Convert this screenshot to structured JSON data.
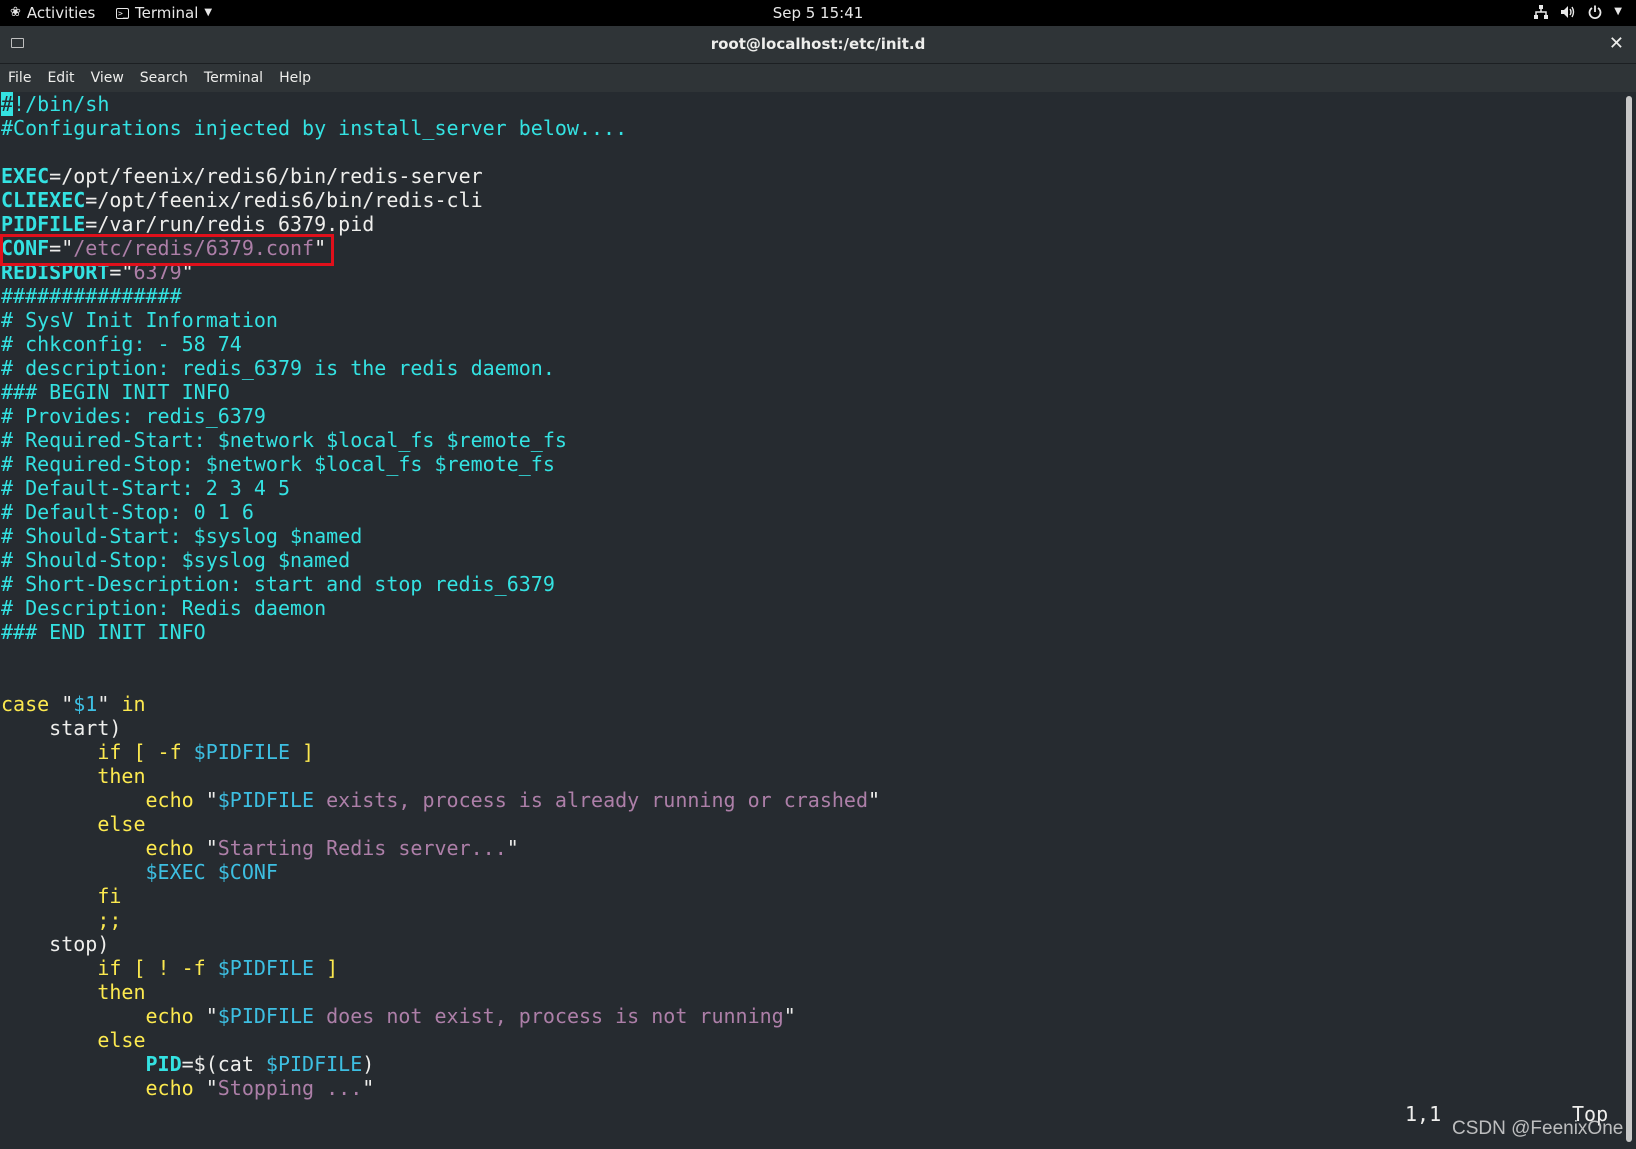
{
  "topbar": {
    "activities_label": "Activities",
    "app_label": "Terminal",
    "clock": "Sep 5  15:41",
    "icons": [
      "network-icon",
      "volume-icon",
      "power-icon",
      "chevron-down-icon"
    ]
  },
  "window": {
    "title": "root@localhost:/etc/init.d",
    "close_glyph": "✕"
  },
  "menubar": {
    "items": [
      "File",
      "Edit",
      "View",
      "Search",
      "Terminal",
      "Help"
    ]
  },
  "terminal": {
    "colors": {
      "background": "#262b30",
      "comment": "#34e2e2",
      "string": "#ad7fa8",
      "keyword": "#fce94f",
      "variable": "#3dbfe2",
      "highlight_box": "#e0101b"
    },
    "lines": [
      [
        {
          "t": "#",
          "c": "cursor"
        },
        {
          "t": "!/bin/sh",
          "c": "c"
        }
      ],
      [
        {
          "t": "#Configurations injected by install_server below....",
          "c": "c"
        }
      ],
      [],
      [
        {
          "t": "EXEC",
          "c": "v"
        },
        {
          "t": "=/opt/feenix/redis6/bin/redis-server",
          "c": ""
        }
      ],
      [
        {
          "t": "CLIEXEC",
          "c": "v"
        },
        {
          "t": "=/opt/feenix/redis6/bin/redis-cli",
          "c": ""
        }
      ],
      [
        {
          "t": "PIDFILE",
          "c": "v"
        },
        {
          "t": "=/var/run/redis_6379.pid",
          "c": ""
        }
      ],
      [
        {
          "t": "CONF",
          "c": "v"
        },
        {
          "t": "=\"",
          "c": ""
        },
        {
          "t": "/etc/redis/6379.conf",
          "c": "s"
        },
        {
          "t": "\"",
          "c": ""
        }
      ],
      [
        {
          "t": "REDISPORT",
          "c": "v"
        },
        {
          "t": "=\"",
          "c": ""
        },
        {
          "t": "6379",
          "c": "s"
        },
        {
          "t": "\"",
          "c": ""
        }
      ],
      [
        {
          "t": "###############",
          "c": "c"
        }
      ],
      [
        {
          "t": "# SysV Init Information",
          "c": "c"
        }
      ],
      [
        {
          "t": "# chkconfig: - 58 74",
          "c": "c"
        }
      ],
      [
        {
          "t": "# description: redis_6379 is the redis daemon.",
          "c": "c"
        }
      ],
      [
        {
          "t": "### BEGIN INIT INFO",
          "c": "c"
        }
      ],
      [
        {
          "t": "# Provides: redis_6379",
          "c": "c"
        }
      ],
      [
        {
          "t": "# Required-Start: $network $local_fs $remote_fs",
          "c": "c"
        }
      ],
      [
        {
          "t": "# Required-Stop: $network $local_fs $remote_fs",
          "c": "c"
        }
      ],
      [
        {
          "t": "# Default-Start: 2 3 4 5",
          "c": "c"
        }
      ],
      [
        {
          "t": "# Default-Stop: 0 1 6",
          "c": "c"
        }
      ],
      [
        {
          "t": "# Should-Start: $syslog $named",
          "c": "c"
        }
      ],
      [
        {
          "t": "# Should-Stop: $syslog $named",
          "c": "c"
        }
      ],
      [
        {
          "t": "# Short-Description: start and stop redis_6379",
          "c": "c"
        }
      ],
      [
        {
          "t": "# Description: Redis daemon",
          "c": "c"
        }
      ],
      [
        {
          "t": "### END INIT INFO",
          "c": "c"
        }
      ],
      [],
      [],
      [
        {
          "t": "case",
          "c": "k"
        },
        {
          "t": " \"",
          "c": ""
        },
        {
          "t": "$1",
          "c": "b"
        },
        {
          "t": "\" ",
          "c": ""
        },
        {
          "t": "in",
          "c": "k"
        }
      ],
      [
        {
          "t": "    start)",
          "c": ""
        }
      ],
      [
        {
          "t": "        ",
          "c": ""
        },
        {
          "t": "if",
          "c": "k"
        },
        {
          "t": " [ -f ",
          "c": "k"
        },
        {
          "t": "$PIDFILE",
          "c": "b"
        },
        {
          "t": " ]",
          "c": "k"
        }
      ],
      [
        {
          "t": "        ",
          "c": ""
        },
        {
          "t": "then",
          "c": "k"
        }
      ],
      [
        {
          "t": "            ",
          "c": ""
        },
        {
          "t": "echo",
          "c": "k"
        },
        {
          "t": " \"",
          "c": ""
        },
        {
          "t": "$PIDFILE",
          "c": "b"
        },
        {
          "t": " exists, process is already running or crashed",
          "c": "s"
        },
        {
          "t": "\"",
          "c": ""
        }
      ],
      [
        {
          "t": "        ",
          "c": ""
        },
        {
          "t": "else",
          "c": "k"
        }
      ],
      [
        {
          "t": "            ",
          "c": ""
        },
        {
          "t": "echo",
          "c": "k"
        },
        {
          "t": " \"",
          "c": ""
        },
        {
          "t": "Starting Redis server...",
          "c": "s"
        },
        {
          "t": "\"",
          "c": ""
        }
      ],
      [
        {
          "t": "            ",
          "c": ""
        },
        {
          "t": "$EXEC $CONF",
          "c": "b"
        }
      ],
      [
        {
          "t": "        ",
          "c": ""
        },
        {
          "t": "fi",
          "c": "k"
        }
      ],
      [
        {
          "t": "        ",
          "c": ""
        },
        {
          "t": ";;",
          "c": "k"
        }
      ],
      [
        {
          "t": "    stop)",
          "c": ""
        }
      ],
      [
        {
          "t": "        ",
          "c": ""
        },
        {
          "t": "if",
          "c": "k"
        },
        {
          "t": " [ ! -f ",
          "c": "k"
        },
        {
          "t": "$PIDFILE",
          "c": "b"
        },
        {
          "t": " ]",
          "c": "k"
        }
      ],
      [
        {
          "t": "        ",
          "c": ""
        },
        {
          "t": "then",
          "c": "k"
        }
      ],
      [
        {
          "t": "            ",
          "c": ""
        },
        {
          "t": "echo",
          "c": "k"
        },
        {
          "t": " \"",
          "c": ""
        },
        {
          "t": "$PIDFILE",
          "c": "b"
        },
        {
          "t": " does not exist, process is not running",
          "c": "s"
        },
        {
          "t": "\"",
          "c": ""
        }
      ],
      [
        {
          "t": "        ",
          "c": ""
        },
        {
          "t": "else",
          "c": "k"
        }
      ],
      [
        {
          "t": "            ",
          "c": ""
        },
        {
          "t": "PID",
          "c": "v"
        },
        {
          "t": "=$(cat ",
          "c": ""
        },
        {
          "t": "$PIDFILE",
          "c": "b"
        },
        {
          "t": ")",
          "c": ""
        }
      ],
      [
        {
          "t": "            ",
          "c": ""
        },
        {
          "t": "echo",
          "c": "k"
        },
        {
          "t": " \"",
          "c": ""
        },
        {
          "t": "Stopping ...",
          "c": "s"
        },
        {
          "t": "\"",
          "c": ""
        }
      ]
    ],
    "status_position": "1,1",
    "status_scroll": "Top"
  },
  "watermark": "CSDN @FeenixOne"
}
